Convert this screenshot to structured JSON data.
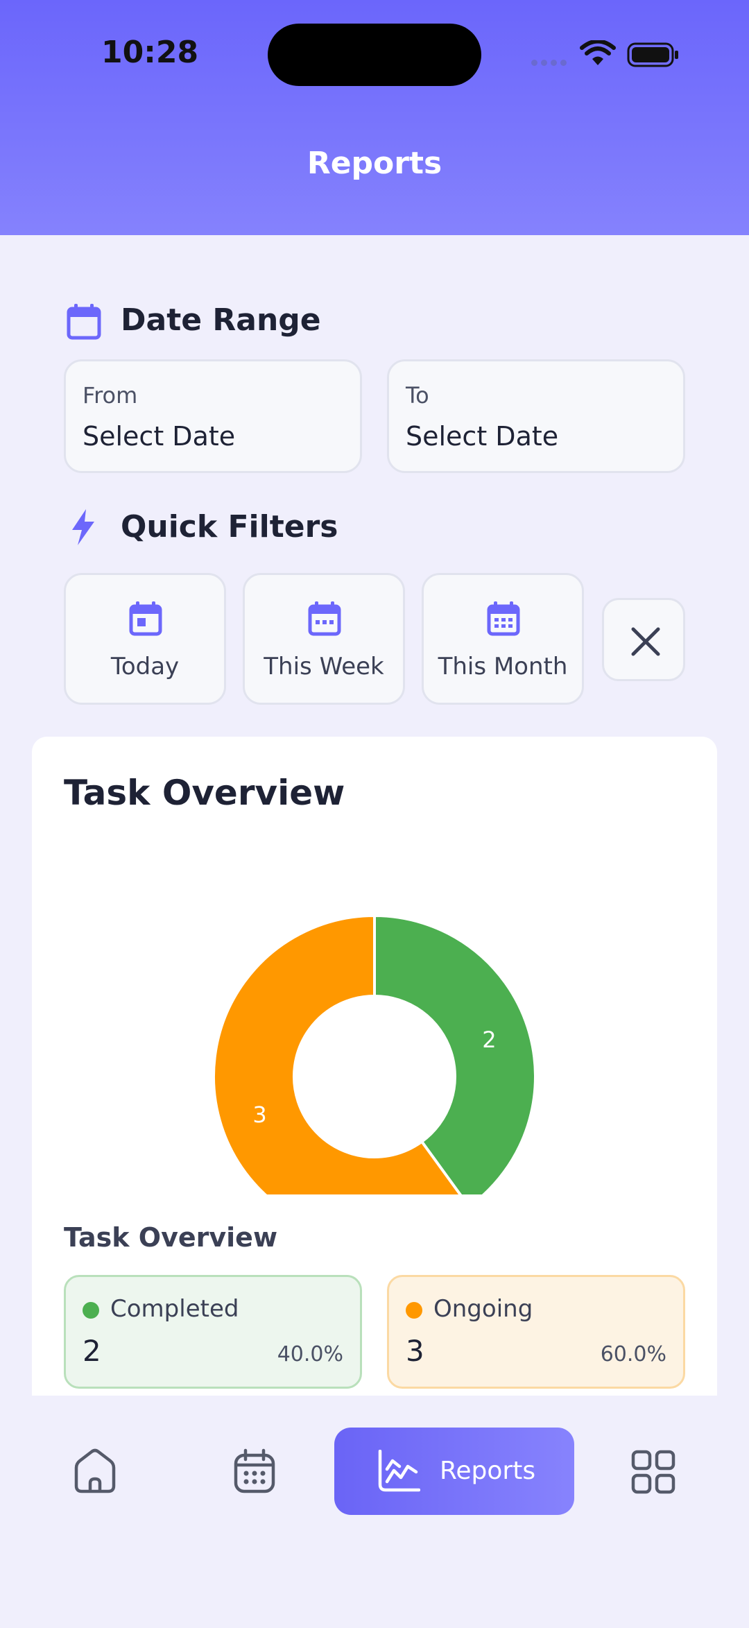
{
  "status_bar": {
    "time": "10:28"
  },
  "header": {
    "title": "Reports"
  },
  "date_range": {
    "title": "Date Range",
    "from": {
      "label": "From",
      "value": "Select Date"
    },
    "to": {
      "label": "To",
      "value": "Select Date"
    }
  },
  "quick_filters": {
    "title": "Quick Filters",
    "items": [
      {
        "label": "Today",
        "icon": "calendar-today-icon"
      },
      {
        "label": "This Week",
        "icon": "calendar-week-icon"
      },
      {
        "label": "This Month",
        "icon": "calendar-month-icon"
      }
    ],
    "clear_icon": "close-icon"
  },
  "task_overview": {
    "title": "Task Overview",
    "legend_title": "Task Overview",
    "stats": [
      {
        "name": "Completed",
        "count": "2",
        "percent": "40.0%",
        "color": "#4caf50"
      },
      {
        "name": "Ongoing",
        "count": "3",
        "percent": "60.0%",
        "color": "#ff9800"
      }
    ]
  },
  "chart_data": {
    "type": "pie",
    "donut": true,
    "categories": [
      "Completed",
      "Ongoing"
    ],
    "values": [
      2,
      3
    ],
    "colors": [
      "#4caf50",
      "#ff9800"
    ],
    "data_labels": [
      "2",
      "3"
    ]
  },
  "bottom_nav": {
    "items": [
      {
        "icon": "home-icon",
        "label": ""
      },
      {
        "icon": "calendar-icon",
        "label": ""
      },
      {
        "icon": "chart-icon",
        "label": "Reports",
        "active": true
      },
      {
        "icon": "grid-icon",
        "label": ""
      }
    ]
  },
  "colors": {
    "accent": "#6c67fb",
    "background": "#f0effc",
    "completed": "#4caf50",
    "ongoing": "#ff9800"
  }
}
